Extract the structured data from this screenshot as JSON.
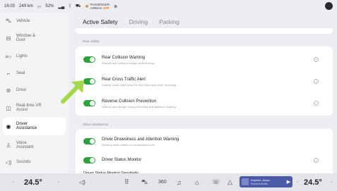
{
  "status": {
    "time": "16:03",
    "range": "249 km",
    "battery": "52%",
    "airbag_line1": "PASSENGER",
    "airbag_line2": "AIRBAG",
    "airbag_state": "OFF"
  },
  "sidebar": {
    "items": [
      {
        "label": "Vehicle",
        "icon": "car-icon"
      },
      {
        "label": "Window & Door",
        "icon": "window-icon"
      },
      {
        "label": "Lights",
        "icon": "lights-icon"
      },
      {
        "label": "Seat",
        "icon": "seat-icon"
      },
      {
        "label": "Drive",
        "icon": "steering-icon"
      },
      {
        "label": "Real-time VR Assist",
        "icon": "vr-icon"
      },
      {
        "label": "Driver Assistance",
        "icon": "assist-icon"
      },
      {
        "label": "Voice Assistant",
        "icon": "voice-icon"
      },
      {
        "label": "Sounds",
        "icon": "speaker-icon"
      }
    ]
  },
  "tabs": [
    "Active Safety",
    "Driving",
    "Parking"
  ],
  "sections": {
    "rear_safety": "Rear Safety",
    "other_assistances": "Other Assistances"
  },
  "rows": {
    "rcw_title": "Rear Collision Warning",
    "rcw_desc": "Detects rear collision danger while driving",
    "rcta_title": "Rear Cross Traffic Alert",
    "rcta_desc": "Detects cross traffic from the rear blind spot while reversing",
    "rcp_title": "Reverse Collision Prevention",
    "rcp_desc": "Detects rear danger during reversing and assists in braking",
    "ddaw_title": "Driver Drowsiness and Attention Warning",
    "ddaw_desc": "Warning driver based on Drowsiness level",
    "dsm_title": "Driver Status Monitor",
    "dsm_sens": "Driver Status Monitor Sensitivity"
  },
  "bottom": {
    "temp_left": "24.5°",
    "temp_right": "24.5°",
    "music_title": "Anytime, Anyw...",
    "music_sub": "Recent Audio"
  },
  "colors": {
    "accent": "#2aa43a",
    "arrow": "#a3d84a"
  }
}
